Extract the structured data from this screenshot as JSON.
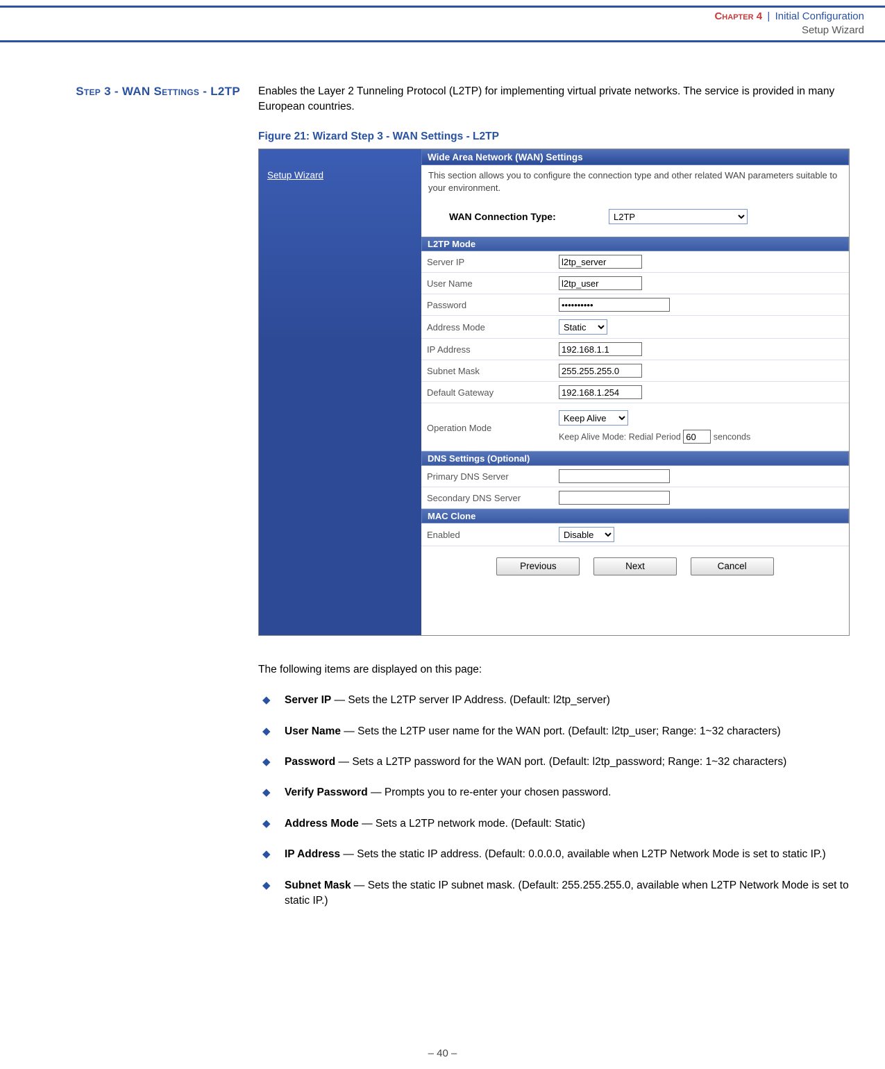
{
  "header": {
    "chapter": "Chapter 4",
    "title": "Initial Configuration",
    "subtitle": "Setup Wizard"
  },
  "sidebar_title": "Step 3 - WAN Settings - L2TP",
  "intro": "Enables the Layer 2 Tunneling Protocol (L2TP) for implementing virtual private networks. The service is provided in many European countries.",
  "figure_caption": "Figure 21:  Wizard Step 3 - WAN Settings - L2TP",
  "screenshot": {
    "side_nav_item": "Setup Wizard",
    "title": "Wide Area Network (WAN) Settings",
    "desc": "This section allows you to configure the connection type and other related WAN parameters suitable to your environment.",
    "conn_label": "WAN Connection Type:",
    "conn_value": "L2TP",
    "sections": {
      "l2tp_mode": "L2TP Mode",
      "dns": "DNS Settings (Optional)",
      "mac": "MAC Clone"
    },
    "fields": {
      "server_ip_label": "Server IP",
      "server_ip_value": "l2tp_server",
      "user_name_label": "User Name",
      "user_name_value": "l2tp_user",
      "password_label": "Password",
      "password_value": "••••••••••",
      "address_mode_label": "Address Mode",
      "address_mode_value": "Static",
      "ip_address_label": "IP Address",
      "ip_address_value": "192.168.1.1",
      "subnet_mask_label": "Subnet Mask",
      "subnet_mask_value": "255.255.255.0",
      "default_gw_label": "Default Gateway",
      "default_gw_value": "192.168.1.254",
      "op_mode_label": "Operation Mode",
      "op_mode_value": "Keep Alive",
      "op_sub_prefix": "Keep Alive Mode: Redial Period ",
      "op_sub_value": "60",
      "op_sub_suffix": " senconds",
      "primary_dns_label": "Primary DNS Server",
      "primary_dns_value": "",
      "secondary_dns_label": "Secondary DNS Server",
      "secondary_dns_value": "",
      "mac_enabled_label": "Enabled",
      "mac_enabled_value": "Disable"
    },
    "buttons": {
      "previous": "Previous",
      "next": "Next",
      "cancel": "Cancel"
    }
  },
  "follow_text": "The following items are displayed on this page:",
  "bullets": [
    {
      "term": "Server IP",
      "desc": " — Sets the L2TP server IP Address. (Default: l2tp_server)"
    },
    {
      "term": "User Name",
      "desc": " — Sets the L2TP user name for the WAN port. (Default: l2tp_user; Range: 1~32 characters)"
    },
    {
      "term": "Password",
      "desc": " — Sets a L2TP password for the WAN port. (Default: l2tp_password; Range: 1~32 characters)"
    },
    {
      "term": "Verify Password",
      "desc": " — Prompts you to re-enter your chosen password."
    },
    {
      "term": "Address Mode",
      "desc": " — Sets a L2TP network mode. (Default: Static)"
    },
    {
      "term": "IP Address",
      "desc": " — Sets the static IP address. (Default: 0.0.0.0, available when L2TP Network Mode is set to static IP.)"
    },
    {
      "term": "Subnet Mask",
      "desc": " — Sets the static IP subnet mask. (Default: 255.255.255.0, available when L2TP Network Mode is set to static IP.)"
    }
  ],
  "page_number": "–  40  –"
}
